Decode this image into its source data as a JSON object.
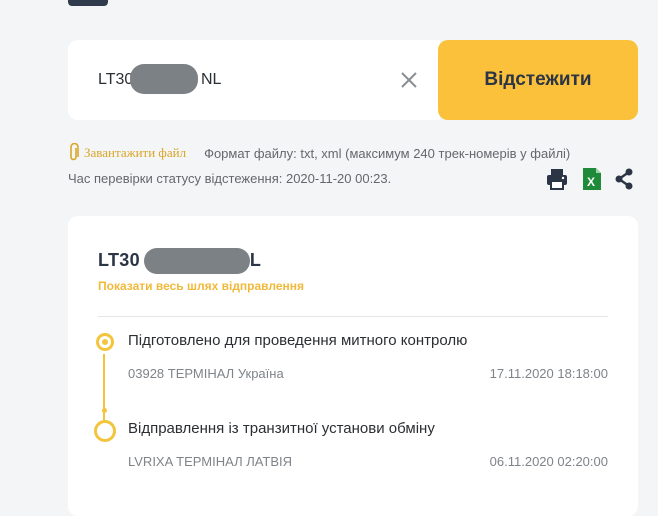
{
  "search": {
    "value": "LT30",
    "value_suffix": "NL",
    "clear_icon": "close-icon",
    "button_label": "Відстежити"
  },
  "upload": {
    "link_label": "Завантажити файл",
    "format_text": "Формат файлу: txt, xml (максимум 240 трек-номерів у файлі)"
  },
  "status_check": {
    "text": "Час перевірки статусу відстеження: 2020-11-20 00:23."
  },
  "tools": [
    {
      "icon": "print-icon"
    },
    {
      "icon": "excel-icon",
      "color": "#1f8b3a"
    },
    {
      "icon": "share-icon"
    }
  ],
  "shipment": {
    "tracking_prefix": "LT30",
    "tracking_suffix": "L",
    "show_path_label": "Показати весь шлях відправлення",
    "events": [
      {
        "title": "Підготовлено для проведення митного контролю",
        "place": "03928 ТЕРМІНАЛ Україна",
        "date": "17.11.2020 18:18:00"
      },
      {
        "title": "Відправлення із транзитної установи обміну",
        "place": "LVRIXA ТЕРМІНАЛ ЛАТВІЯ",
        "date": "06.11.2020 02:20:00"
      }
    ]
  },
  "colors": {
    "accent": "#fbc13a",
    "timeline": "#f2c53d",
    "link": "#d9a62a"
  }
}
